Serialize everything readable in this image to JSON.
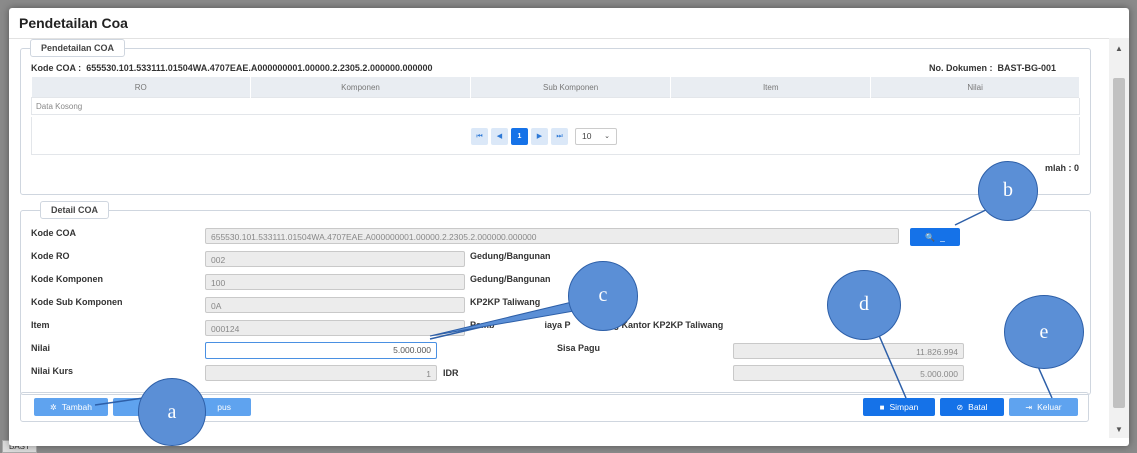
{
  "background": {
    "bottom_tab": "BAST"
  },
  "modal": {
    "title": "Pendetailan Coa"
  },
  "coa_section": {
    "legend": "Pendetailan COA",
    "kode_coa_label": "Kode COA :",
    "kode_coa_value": "655530.101.533111.01504WA.4707EAE.A000000001.00000.2.2305.2.000000.000000",
    "no_dokumen_label": "No. Dokumen :",
    "no_dokumen_value": "BAST-BG-001",
    "columns": [
      "RO",
      "Komponen",
      "Sub Komponen",
      "Item",
      "Nilai"
    ],
    "empty_text": "Data Kosong",
    "pager": {
      "first": "⏮",
      "prev": "◀",
      "current": "1",
      "next": "▶",
      "last": "⏭",
      "page_size": "10"
    },
    "jumlah": "mlah : 0"
  },
  "detail_section": {
    "legend": "Detail COA",
    "kode_coa_label": "Kode COA",
    "kode_coa_value": "655530.101.533111.01504WA.4707EAE.A000000001.00000.2.2305.2.000000.000000",
    "search_button": "_",
    "kode_ro_label": "Kode RO",
    "kode_ro_value": "002",
    "kode_ro_desc": "Gedung/Bangunan",
    "kode_komponen_label": "Kode Komponen",
    "kode_komponen_value": "100",
    "kode_komponen_desc": "Gedung/Bangunan",
    "kode_sub_label": "Kode Sub Komponen",
    "kode_sub_value": "0A",
    "kode_sub_desc": "KP2KP Taliwang",
    "item_label": "Item",
    "item_value": "000124",
    "item_desc_left": "Pemb",
    "item_desc_mid": "iaya P",
    "item_desc_right": "ung Kantor KP2KP Taliwang",
    "nilai_label": "Nilai",
    "nilai_value": "5.000.000",
    "sisa_pagu_label": "Sisa Pagu",
    "sisa_pagu_value": "11.826.994",
    "nilai_kurs_label": "Nilai Kurs",
    "nilai_kurs_value": "1",
    "currency": "IDR",
    "total_value": "5.000.000"
  },
  "footer": {
    "tambah": "Tambah",
    "hapus": "pus",
    "simpan": "Simpan",
    "batal": "Batal",
    "keluar": "Keluar"
  },
  "callouts": [
    "a",
    "b",
    "c",
    "d",
    "e"
  ],
  "colors": {
    "primary": "#1572e8",
    "callout": "#5b8fd6"
  }
}
